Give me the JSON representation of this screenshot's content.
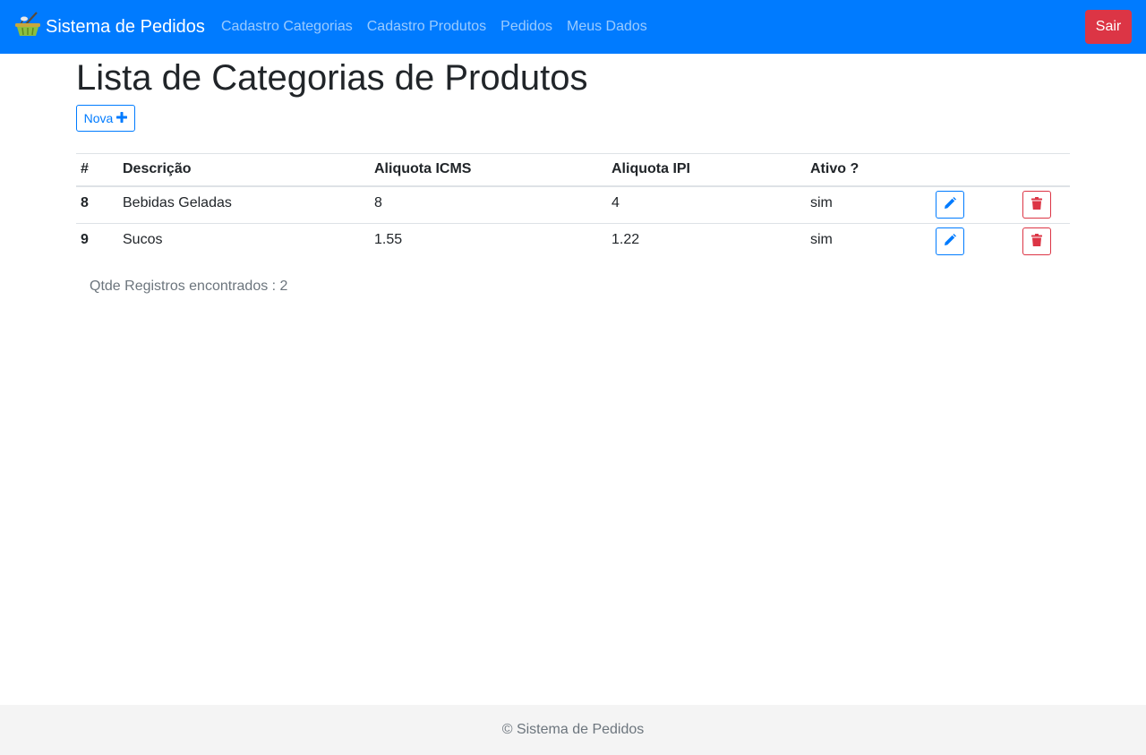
{
  "navbar": {
    "brand": "Sistema de Pedidos",
    "brand_icon": "basket-icon",
    "links": [
      "Cadastro Categorias",
      "Cadastro Produtos",
      "Pedidos",
      "Meus Dados"
    ],
    "logout_label": "Sair",
    "colors": {
      "background": "#007bff",
      "logout": "#dc3545"
    }
  },
  "page": {
    "title": "Lista de Categorias de Produtos",
    "new_button_label": "Nova",
    "new_button_icon": "plus-icon"
  },
  "table": {
    "headers": [
      "#",
      "Descrição",
      "Aliquota ICMS",
      "Aliquota IPI",
      "Ativo ?"
    ],
    "rows": [
      {
        "id": "8",
        "descricao": "Bebidas Geladas",
        "icms": "8",
        "ipi": "4",
        "ativo": "sim"
      },
      {
        "id": "9",
        "descricao": "Sucos",
        "icms": "1.55",
        "ipi": "1.22",
        "ativo": "sim"
      }
    ],
    "row_actions": [
      "pencil-icon",
      "trash-icon"
    ]
  },
  "summary": {
    "count_text": "Qtde Registros encontrados : 2"
  },
  "footer": {
    "text": "© Sistema de Pedidos"
  }
}
